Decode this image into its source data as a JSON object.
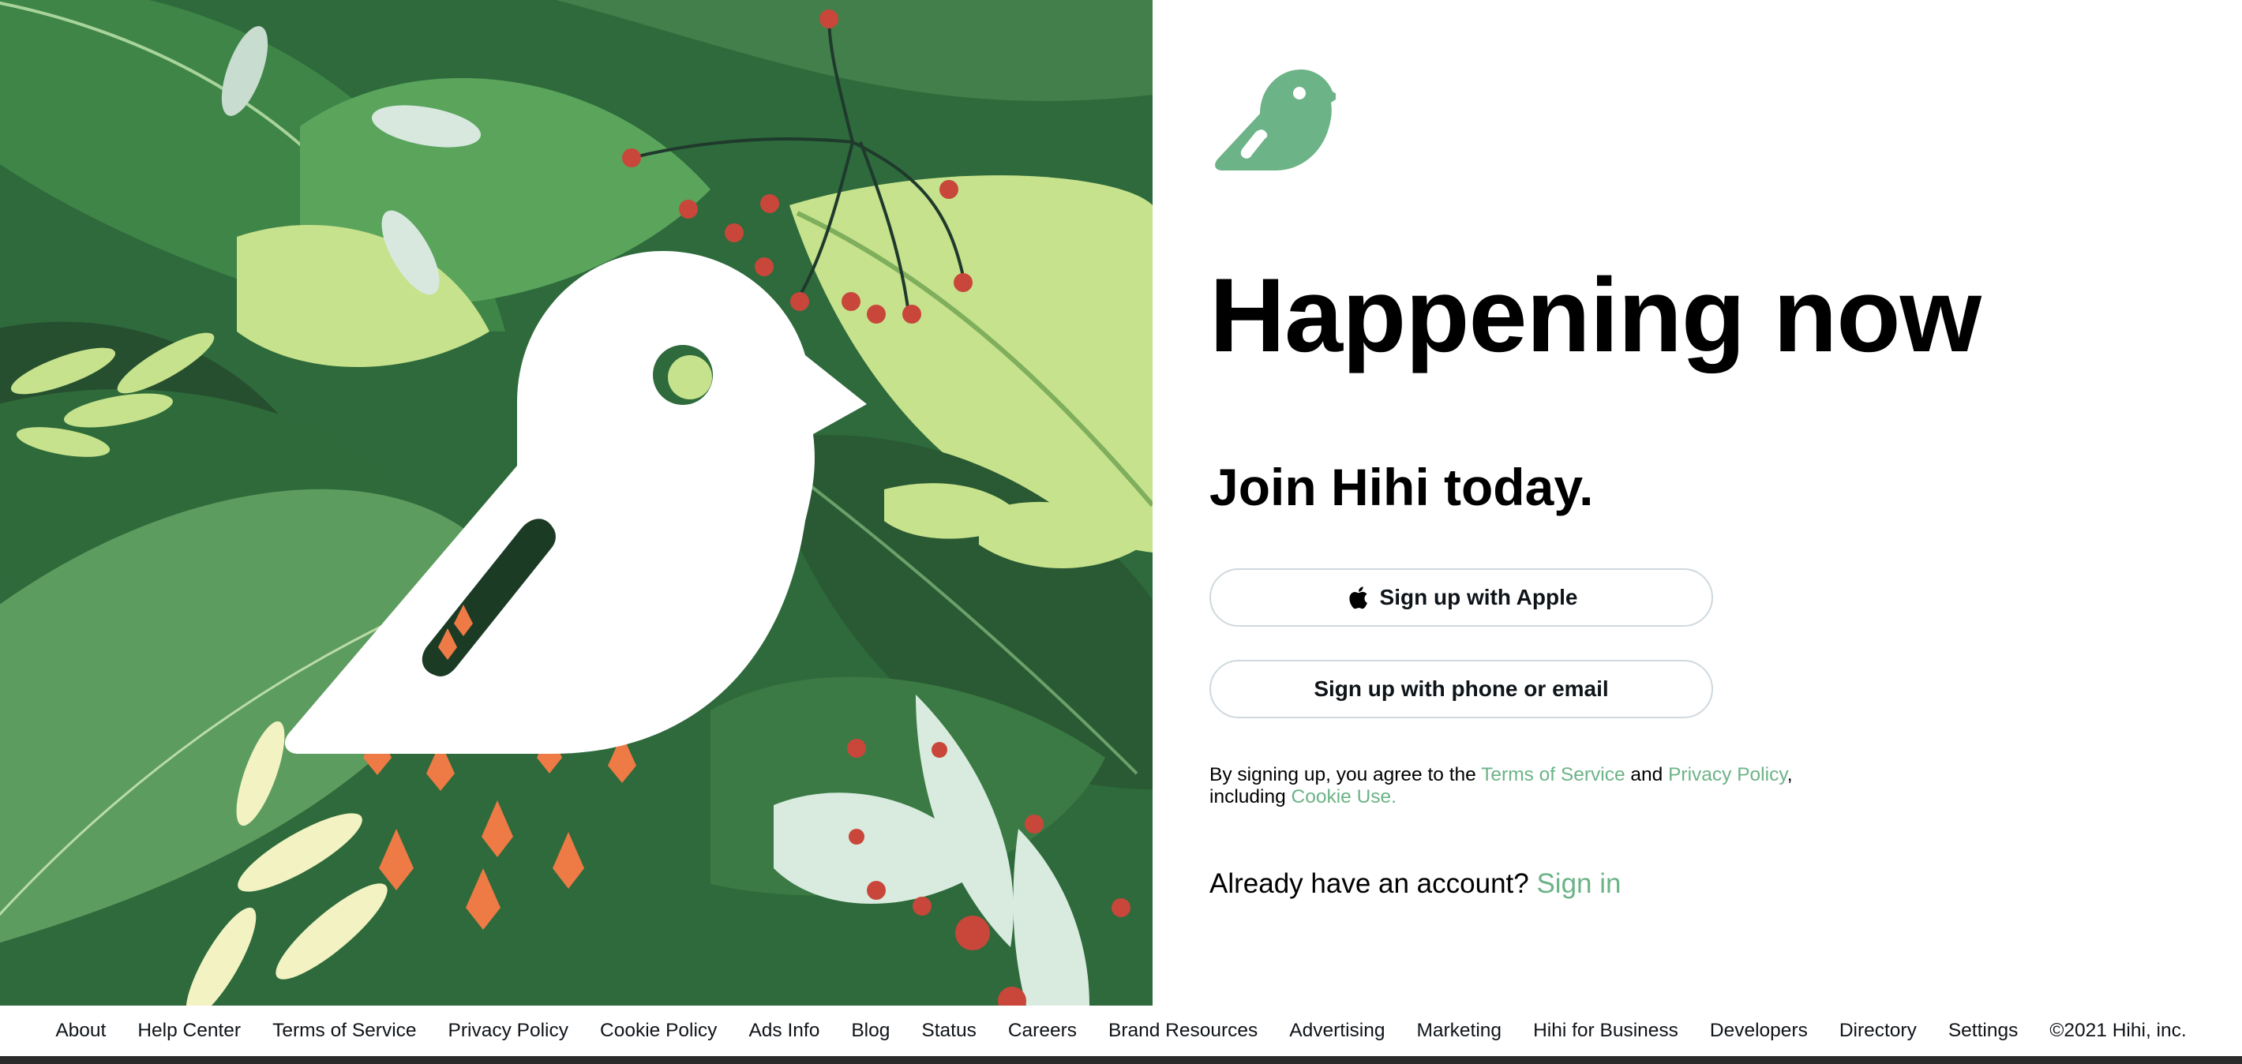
{
  "colors": {
    "brand_green": "#6cb387",
    "dark_green": "#1f4a2a",
    "leaf_mid": "#4f9a55",
    "leaf_light": "#c6e28c",
    "berry_red": "#c8473a",
    "flower_orange": "#ee7a45"
  },
  "hero": {
    "image_name": "jungle-leaves-bird-illustration"
  },
  "logo": {
    "icon": "bird-icon"
  },
  "main": {
    "headline": "Happening now",
    "subheadline": "Join Hihi today.",
    "apple_button": {
      "icon": "apple-icon",
      "label": "Sign up with Apple"
    },
    "phone_email_button": {
      "label": "Sign up with phone or email"
    },
    "legal": {
      "prefix": "By signing up, you agree to the ",
      "terms_link": "Terms of Service",
      "and": " and ",
      "privacy_link": "Privacy Policy",
      "comma": ",",
      "including": "including ",
      "cookie_link": "Cookie Use."
    },
    "signin": {
      "prompt": "Already have an account? ",
      "link": "Sign in"
    }
  },
  "footer": {
    "links": [
      "About",
      "Help Center",
      "Terms of Service",
      "Privacy Policy",
      "Cookie Policy",
      "Ads Info",
      "Blog",
      "Status",
      "Careers",
      "Brand Resources",
      "Advertising",
      "Marketing",
      "Hihi for Business",
      "Developers",
      "Directory",
      "Settings"
    ],
    "copyright": "©2021 Hihi, inc."
  }
}
